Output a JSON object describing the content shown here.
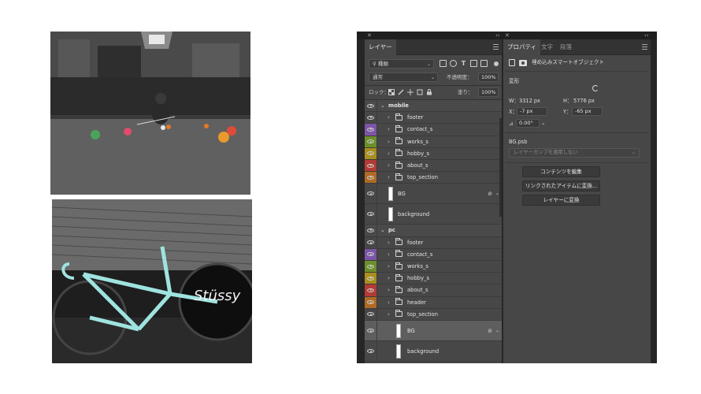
{
  "layers_panel": {
    "tab_label": "レイヤー",
    "filter_kind": "種類",
    "blend_mode": "通常",
    "opacity_label": "不透明度：",
    "opacity_value": "100%",
    "lock_label": "ロック：",
    "fill_label": "塗り：",
    "fill_value": "100%",
    "groups": [
      {
        "name": "mobile",
        "layers": [
          {
            "name": "footer",
            "color": "#474747"
          },
          {
            "name": "contact_s",
            "color": "#7d55a6"
          },
          {
            "name": "works_s",
            "color": "#6b8f2b"
          },
          {
            "name": "hobby_s",
            "color": "#a88f1e"
          },
          {
            "name": "about_s",
            "color": "#b33b36"
          },
          {
            "name": "top_section",
            "color": "#b06a23"
          }
        ],
        "smart_layer": "BG",
        "bottom_layer": "background"
      },
      {
        "name": "pc",
        "layers": [
          {
            "name": "footer",
            "color": "#474747"
          },
          {
            "name": "contact_s",
            "color": "#7d55a6"
          },
          {
            "name": "works_s",
            "color": "#6b8f2b"
          },
          {
            "name": "hobby_s",
            "color": "#a88f1e"
          },
          {
            "name": "about_s",
            "color": "#b33b36"
          },
          {
            "name": "header",
            "color": "#b06a23"
          },
          {
            "name": "top_section",
            "color": "#474747"
          }
        ],
        "smart_layer": "BG",
        "bottom_layer": "background"
      }
    ]
  },
  "props_panel": {
    "tabs": [
      "プロパティ",
      "文字",
      "段落"
    ],
    "header": "埋め込みスマートオブジェクト",
    "transform_label": "変形",
    "w_label": "W：",
    "w_value": "3312 px",
    "h_label": "H：",
    "h_value": "5776 px",
    "x_label": "X：",
    "x_value": "-7 px",
    "y_label": "Y：",
    "y_value": "-65 px",
    "angle_value": "0.00°",
    "file_name": "BG.psb",
    "comp_placeholder": "レイヤーカンプを適用しない",
    "buttons": [
      "コンテンツを編集",
      "リンクされたアイテムに変換...",
      "レイヤーに変換"
    ]
  },
  "photos": {
    "billiards_label": "pool table photo",
    "bicycle_label": "bicycle photo"
  }
}
